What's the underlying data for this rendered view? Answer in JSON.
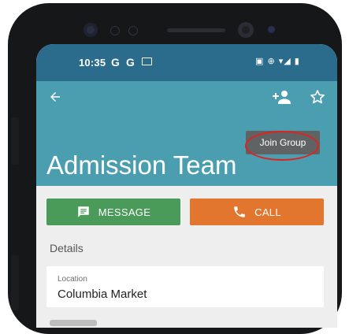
{
  "status_bar": {
    "time": "10:35",
    "notifications": [
      "G",
      "G"
    ],
    "right_icons": "▣ ⊕ ▾◢ ▮"
  },
  "app_bar": {
    "title": "Admission Team",
    "tooltip": "Join Group",
    "background": "#4a9eaf",
    "icons": [
      "back-arrow-icon",
      "add-person-icon",
      "star-outline-icon"
    ]
  },
  "actions": {
    "message_label": "MESSAGE",
    "call_label": "CALL",
    "message_color": "#4a9a5a",
    "call_color": "#e2762f"
  },
  "details": {
    "section_title": "Details",
    "location_label": "Location",
    "location_value": "Columbia Market"
  },
  "annotation": {
    "ring_color": "#e0221f"
  }
}
